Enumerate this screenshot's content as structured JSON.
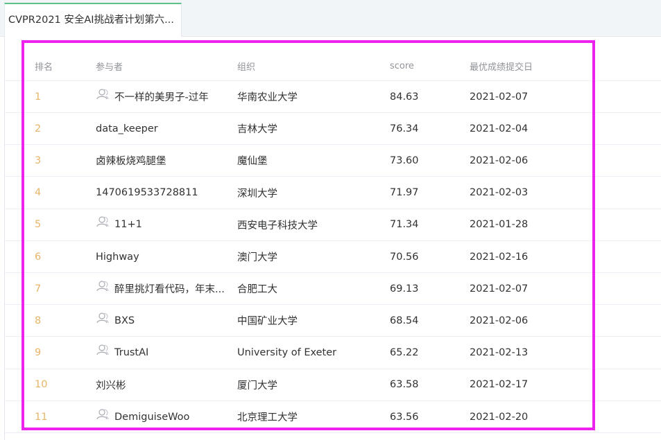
{
  "tab": {
    "title": "CVPR2021 安全AI挑战者计划第六..."
  },
  "columns": {
    "rank": "排名",
    "participant": "参与者",
    "org": "组织",
    "score": "score",
    "date": "最优成绩提交日"
  },
  "rows": [
    {
      "rank": "1",
      "name": "不一样的美男子-过年",
      "org": "华南农业大学",
      "score": "84.63",
      "date": "2021-02-07",
      "team": true
    },
    {
      "rank": "2",
      "name": "data_keeper",
      "org": "吉林大学",
      "score": "76.34",
      "date": "2021-02-04",
      "team": false
    },
    {
      "rank": "3",
      "name": "卤辣板烧鸡腿堡",
      "org": "魔仙堡",
      "score": "73.60",
      "date": "2021-02-06",
      "team": false
    },
    {
      "rank": "4",
      "name": "1470619533728811",
      "org": "深圳大学",
      "score": "71.97",
      "date": "2021-02-03",
      "team": false
    },
    {
      "rank": "5",
      "name": "11+1",
      "org": "西安电子科技大学",
      "score": "71.34",
      "date": "2021-01-28",
      "team": true
    },
    {
      "rank": "6",
      "name": "Highway",
      "org": "澳门大学",
      "score": "70.56",
      "date": "2021-02-16",
      "team": false
    },
    {
      "rank": "7",
      "name": "醉里挑灯看代码，年末...",
      "org": "合肥工大",
      "score": "69.13",
      "date": "2021-02-07",
      "team": true
    },
    {
      "rank": "8",
      "name": "BXS",
      "org": "中国矿业大学",
      "score": "68.54",
      "date": "2021-02-06",
      "team": true
    },
    {
      "rank": "9",
      "name": "TrustAI",
      "org": "University of Exeter",
      "score": "65.22",
      "date": "2021-02-13",
      "team": true
    },
    {
      "rank": "10",
      "name": "刘兴彬",
      "org": "厦门大学",
      "score": "63.58",
      "date": "2021-02-17",
      "team": false
    },
    {
      "rank": "11",
      "name": "DemiguiseWoo",
      "org": "北京理工大学",
      "score": "63.56",
      "date": "2021-02-20",
      "team": true
    }
  ],
  "colors": {
    "rank": "#e8b468",
    "highlight": "#ee22ee",
    "tab_accent": "#5cc28a"
  }
}
